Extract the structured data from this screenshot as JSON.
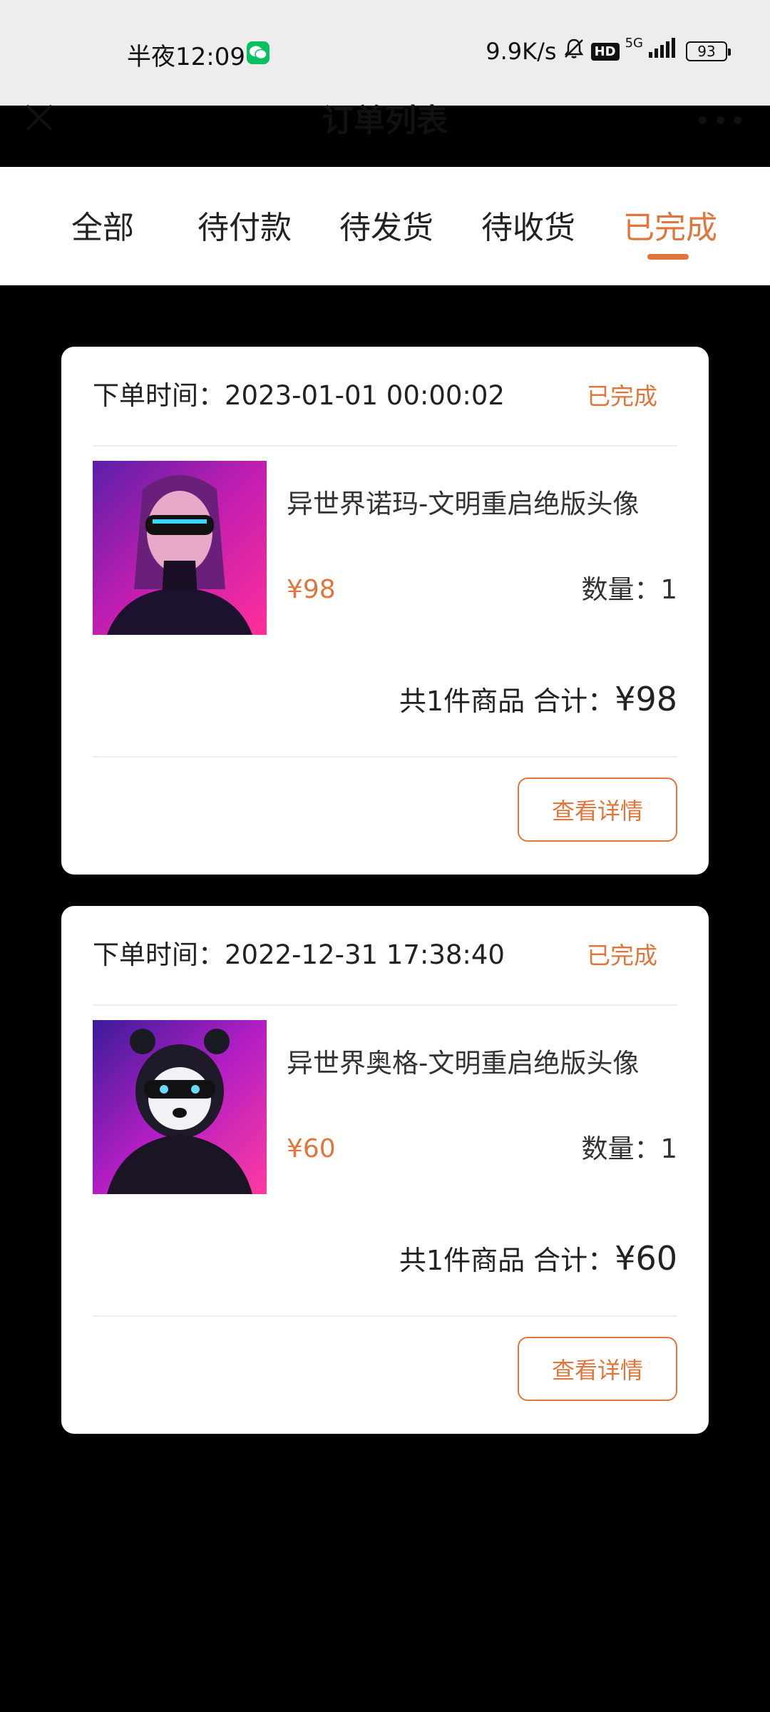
{
  "status_bar": {
    "time": "半夜12:09",
    "speed": "9.9K/s",
    "hd": "HD",
    "network": "5G",
    "battery": "93"
  },
  "navbar": {
    "title": "订单列表",
    "close_icon": "close-icon",
    "more_icon": "more-icon"
  },
  "tabs": [
    {
      "label": "全部",
      "active": false
    },
    {
      "label": "待付款",
      "active": false
    },
    {
      "label": "待发货",
      "active": false
    },
    {
      "label": "待收货",
      "active": false
    },
    {
      "label": "已完成",
      "active": true
    }
  ],
  "colors": {
    "accent": "#e0763b",
    "page_background": "#000000",
    "card_background": "#ffffff"
  },
  "orders": [
    {
      "time": "下单时间：2023-01-01 00:00:02",
      "status": "已完成",
      "product_name": "异世界诺玛-文明重启绝版头像",
      "price": "¥98",
      "quantity": "数量：1",
      "summary_count": "共1件商品 合计：",
      "summary_total": "¥98",
      "detail_button": "查看详情"
    },
    {
      "time": "下单时间：2022-12-31 17:38:40",
      "status": "已完成",
      "product_name": "异世界奥格-文明重启绝版头像",
      "price": "¥60",
      "quantity": "数量：1",
      "summary_count": "共1件商品 合计：",
      "summary_total": "¥60",
      "detail_button": "查看详情"
    }
  ]
}
